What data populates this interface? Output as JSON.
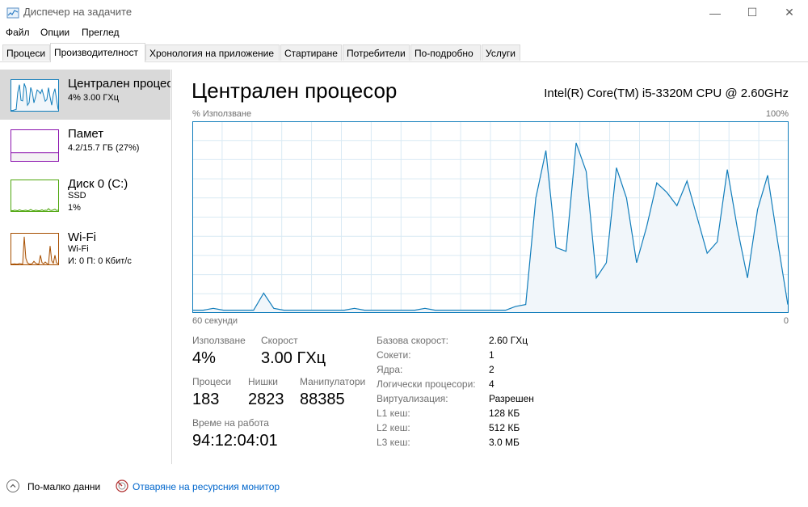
{
  "window": {
    "title": "Диспечер на задачите",
    "icon": "task-manager-icon",
    "minimize_icon": "—",
    "maximize_icon": "☐",
    "close_icon": "✕"
  },
  "menu": [
    "Файл",
    "Опции",
    "Преглед"
  ],
  "tabs": [
    {
      "label": "Процеси",
      "active": false
    },
    {
      "label": "Производителност",
      "active": true
    },
    {
      "label": "Хронология на приложение",
      "active": false
    },
    {
      "label": "Стартиране",
      "active": false
    },
    {
      "label": "Потребители",
      "active": false
    },
    {
      "label": "По-подробно",
      "active": false
    },
    {
      "label": "Услуги",
      "active": false
    }
  ],
  "sidebar": {
    "items": [
      {
        "title": "Централен процесор",
        "sub1": "4% 3.00 ГХц",
        "sub2": "",
        "color": "#117dbb",
        "fill": "#f1f6fa",
        "selected": true
      },
      {
        "title": "Памет",
        "sub1": "4.2/15.7 ГБ (27%)",
        "sub2": "",
        "color": "#8b12ae",
        "fill": "#f4f2f4",
        "selected": false
      },
      {
        "title": "Диск 0 (C:)",
        "sub1": "SSD",
        "sub2": "1%",
        "color": "#4da60c",
        "fill": "#eff7ec",
        "selected": false
      },
      {
        "title": "Wi-Fi",
        "sub1": "Wi-Fi",
        "sub2": "И: 0 П: 0 Кбит/с",
        "color": "#a74f01",
        "fill": "#fcf3eb",
        "selected": false
      }
    ]
  },
  "main": {
    "title": "Централен процесор",
    "cpu_model": "Intel(R) Core(TM) i5-3320M CPU @ 2.60GHz",
    "graph": {
      "ylabel": "% Използване",
      "ymax_label": "100%",
      "xleft_label": "60 секунди",
      "xright_label": "0",
      "line_color": "#117dbb",
      "fill_color": "#f1f6fa",
      "grid_color": "#d9eaf4",
      "usage": [
        1,
        1,
        2,
        1,
        1,
        1,
        1,
        10,
        2,
        1,
        1,
        1,
        1,
        1,
        1,
        1,
        2,
        1,
        1,
        1,
        1,
        1,
        1,
        2,
        1,
        1,
        1,
        1,
        1,
        1,
        1,
        1,
        3,
        4,
        60,
        85,
        34,
        32,
        89,
        74,
        18,
        26,
        76,
        60,
        26,
        45,
        68,
        63,
        56,
        69,
        50,
        31,
        37,
        75,
        44,
        18,
        54,
        72,
        37,
        4
      ]
    },
    "stats": {
      "usage_label": "Използване",
      "usage_value": "4%",
      "speed_label": "Скорост",
      "speed_value": "3.00 ГХц",
      "processes_label": "Процеси",
      "processes_value": "183",
      "threads_label": "Нишки",
      "threads_value": "2823",
      "handles_label": "Манипулатори",
      "handles_value": "88385",
      "uptime_label": "Време на работа",
      "uptime_value": "94:12:04:01"
    },
    "info": [
      {
        "label": "Базова скорост:",
        "value": "2.60 ГХц"
      },
      {
        "label": "Сокети:",
        "value": "1"
      },
      {
        "label": "Ядра:",
        "value": "2"
      },
      {
        "label": "Логически процесори:",
        "value": "4"
      },
      {
        "label": "Виртуализация:",
        "value": "Разрешен"
      },
      {
        "label": "L1 кеш:",
        "value": "128 КБ"
      },
      {
        "label": "L2 кеш:",
        "value": "512 КБ"
      },
      {
        "label": "L3 кеш:",
        "value": "3.0 МБ"
      }
    ]
  },
  "footer": {
    "fewer_details": "По-малко данни",
    "resource_monitor": "Отваряне на ресурсния монитор"
  }
}
